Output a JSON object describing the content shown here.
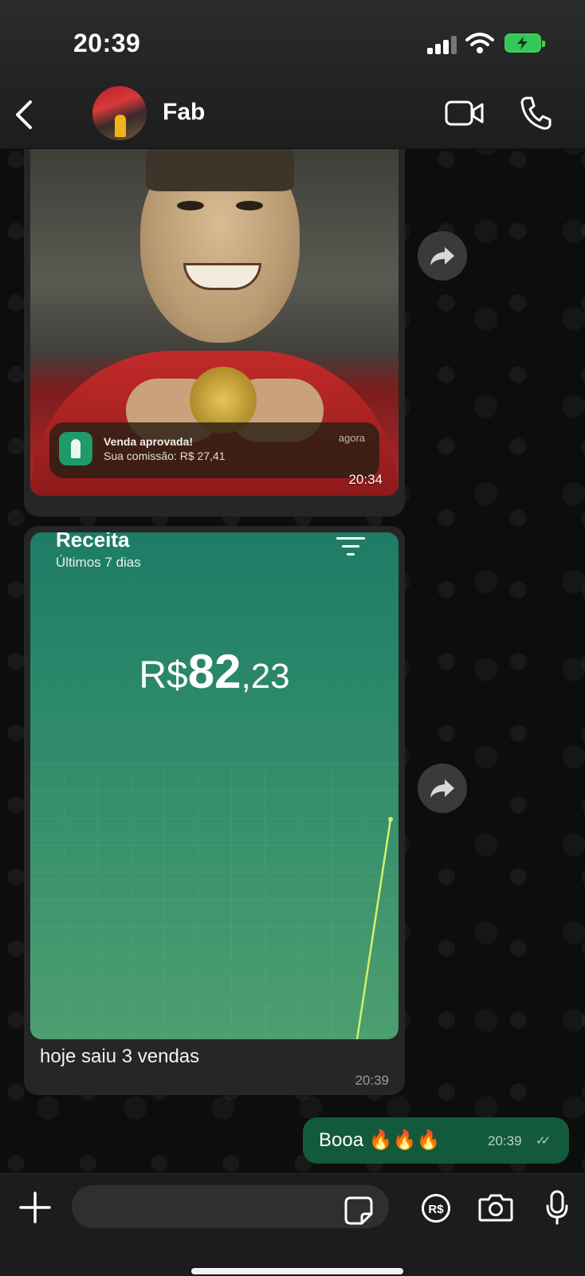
{
  "status_bar": {
    "time": "20:39"
  },
  "header": {
    "contact_name": "Fab"
  },
  "messages": [
    {
      "type": "image",
      "notification": {
        "title": "Venda aprovada!",
        "body": "Sua comissão: R$ 27,41",
        "time": "agora"
      },
      "time": "20:34"
    },
    {
      "type": "image_caption",
      "screenshot": {
        "title": "Receita",
        "subtitle": "Últimos 7 dias",
        "currency": "R$",
        "amount_int": "82",
        "amount_dec": ",23"
      },
      "caption": "hoje saiu 3 vendas",
      "time": "20:39"
    },
    {
      "type": "outgoing_text",
      "text": "Booa 🔥🔥🔥",
      "time": "20:39",
      "status": "read"
    }
  ],
  "icons": {
    "back": "chevron-left-icon",
    "video": "video-camera-icon",
    "call": "phone-icon",
    "forward": "forward-arrow-icon",
    "plus": "plus-icon",
    "sticker": "sticker-icon",
    "pix": "pix-payment-icon",
    "camera": "camera-icon",
    "mic": "microphone-icon"
  },
  "colors": {
    "outgoing_bubble": "#135a3c",
    "incoming_bubble": "#262626",
    "battery": "#34c759"
  }
}
